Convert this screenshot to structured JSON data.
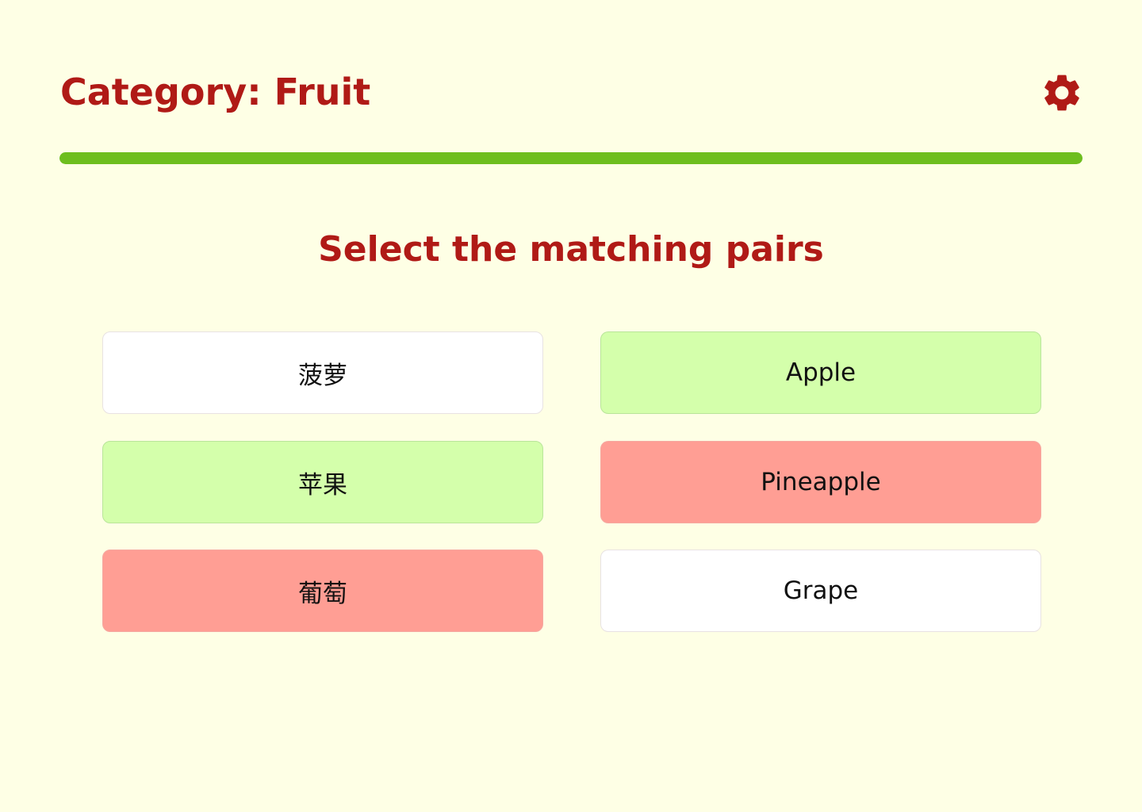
{
  "header": {
    "title": "Category: Fruit",
    "settings_icon": "gear-icon"
  },
  "progress": {
    "fraction": 1.0
  },
  "instruction": "Select the matching pairs",
  "colors": {
    "background": "#FEFFE5",
    "title": "#B01A16",
    "progress_fill": "#6DBE1E",
    "tile_default": "#FFFFFF",
    "tile_correct": "#D4FFAB",
    "tile_incorrect": "#FF9E94"
  },
  "left_tiles": [
    {
      "label": "菠萝",
      "state": "default"
    },
    {
      "label": "苹果",
      "state": "correct"
    },
    {
      "label": "葡萄",
      "state": "incorrect"
    }
  ],
  "right_tiles": [
    {
      "label": "Apple",
      "state": "correct"
    },
    {
      "label": "Pineapple",
      "state": "incorrect"
    },
    {
      "label": "Grape",
      "state": "default"
    }
  ]
}
